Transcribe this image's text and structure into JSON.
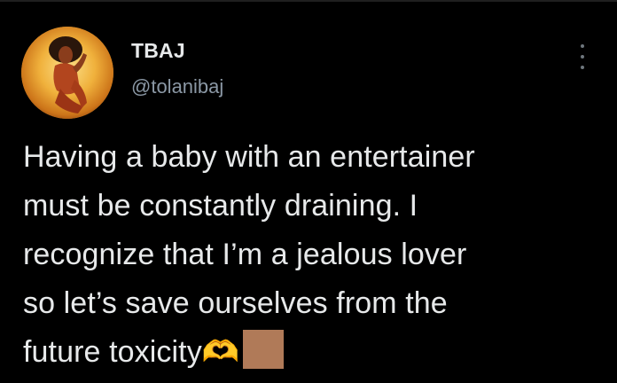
{
  "tweet": {
    "display_name": "TBAJ",
    "username": "@tolanibaj",
    "text": "Having a baby with an entertainer\nmust be constantly draining. I\nrecognize that I’m a jealous lover\nso let’s save ourselves from the\nfuture toxicity",
    "trailing_glyph": "🫶",
    "emoji_color": "#b07a58"
  },
  "icons": {
    "more": "more-vertical-icon",
    "avatar": "profile-photo"
  },
  "colors": {
    "background": "#000000",
    "primary_text": "#e7e9ea",
    "secondary_text": "#8b98a5"
  }
}
